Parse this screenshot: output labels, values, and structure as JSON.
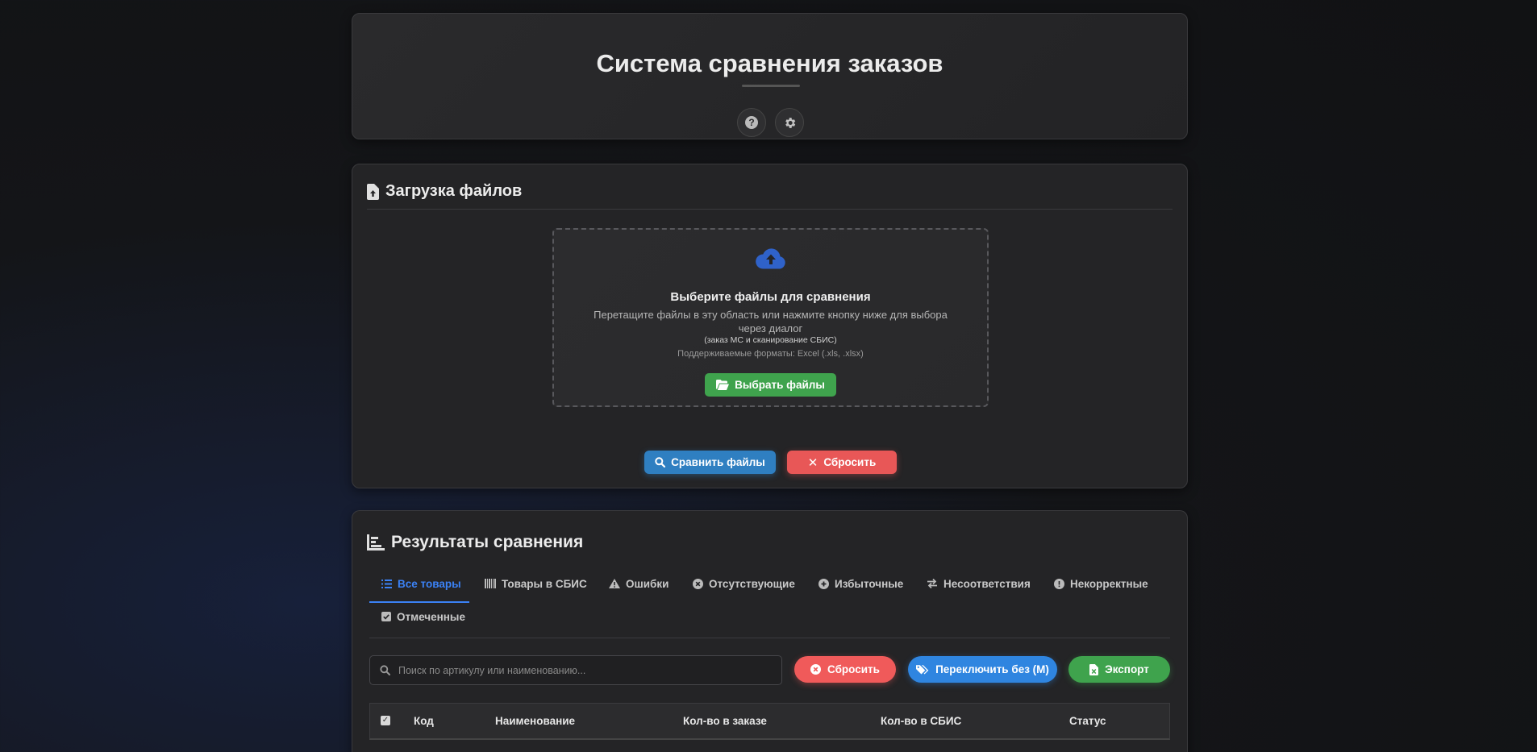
{
  "header": {
    "title": "Система сравнения заказов"
  },
  "upload": {
    "title": "Загрузка файлов",
    "dropzone_title": "Выберите файлы для сравнения",
    "dropzone_desc": "Перетащите файлы в эту область или нажмите кнопку ниже для выбора через диалог",
    "dropzone_note": "(заказ МС и сканирование СБИС)",
    "formats": "Поддерживаемые форматы: Excel (.xls, .xlsx)",
    "choose_label": "Выбрать файлы",
    "compare_label": "Сравнить файлы",
    "reset_label": "Сбросить"
  },
  "results": {
    "title": "Результаты сравнения",
    "tabs": [
      {
        "label": "Все товары",
        "icon": "list-icon",
        "active": true
      },
      {
        "label": "Товары в СБИС",
        "icon": "barcode-icon"
      },
      {
        "label": "Ошибки",
        "icon": "warning-icon"
      },
      {
        "label": "Отсутствующие",
        "icon": "times-circle-icon"
      },
      {
        "label": "Избыточные",
        "icon": "plus-circle-icon"
      },
      {
        "label": "Несоответствия",
        "icon": "exchange-icon"
      },
      {
        "label": "Некорректные",
        "icon": "exclamation-circle-icon"
      },
      {
        "label": "Отмеченные",
        "icon": "check-square-icon"
      }
    ],
    "search_placeholder": "Поиск по артикулу или наименованию...",
    "reset_label": "Сбросить",
    "toggle_label": "Переключить без (М)",
    "export_label": "Экспорт",
    "columns": [
      "Код",
      "Наименование",
      "Кол-во в заказе",
      "Кол-во в СБИС",
      "Статус"
    ]
  },
  "colors": {
    "accent_blue": "#3b82f6",
    "success_green": "#3fa34d",
    "danger_red": "#e85757",
    "primary_blue": "#2f7fc1"
  }
}
